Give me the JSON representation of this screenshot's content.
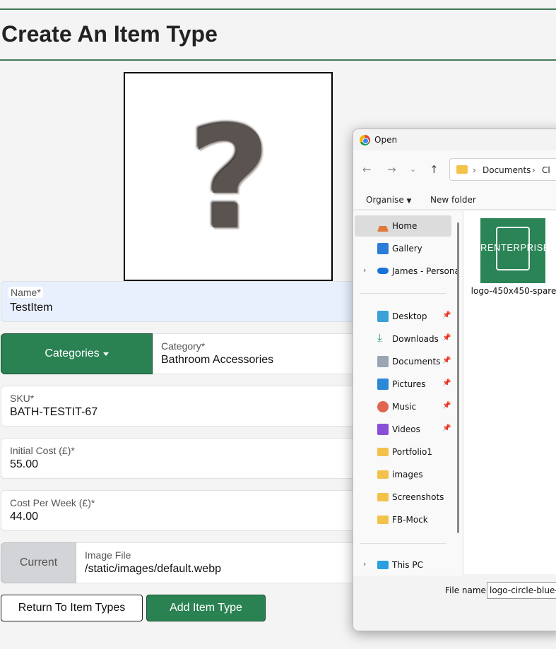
{
  "page": {
    "title": "Create An Item Type",
    "preview_glyph": "?"
  },
  "form": {
    "name": {
      "label": "Name*",
      "value": "TestItem"
    },
    "categories_button": "Categories",
    "category": {
      "label": "Category*",
      "value": "Bathroom Accessories"
    },
    "sku": {
      "label": "SKU*",
      "value": "BATH-TESTIT-67"
    },
    "initial_cost": {
      "label": "Initial Cost (£)*",
      "value": "55.00"
    },
    "cost_per_week": {
      "label": "Cost Per Week (£)*",
      "value": "44.00"
    },
    "current_button": "Current",
    "image_file": {
      "label": "Image File",
      "value": "/static/images/default.webp"
    },
    "return_button": "Return To Item Types",
    "add_button": "Add Item Type"
  },
  "dialog": {
    "title": "Open",
    "address": [
      "Documents",
      "Cl"
    ],
    "toolbar": {
      "organise": "Organise",
      "new_folder": "New folder"
    },
    "nav": [
      {
        "label": "Home",
        "icon": "home-icon"
      },
      {
        "label": "Gallery",
        "icon": "gallery-icon"
      },
      {
        "label": "James - Persona",
        "icon": "onedrive-icon"
      },
      {
        "label": "Desktop",
        "icon": "desktop-icon"
      },
      {
        "label": "Downloads",
        "icon": "download-icon"
      },
      {
        "label": "Documents",
        "icon": "document-icon"
      },
      {
        "label": "Pictures",
        "icon": "pictures-icon"
      },
      {
        "label": "Music",
        "icon": "music-icon"
      },
      {
        "label": "Videos",
        "icon": "video-icon"
      },
      {
        "label": "Portfolio1",
        "icon": "folder-icon"
      },
      {
        "label": "images",
        "icon": "folder-icon"
      },
      {
        "label": "Screenshots",
        "icon": "folder-icon"
      },
      {
        "label": "FB-Mock",
        "icon": "folder-icon"
      },
      {
        "label": "This PC",
        "icon": "pc-icon"
      }
    ],
    "file": {
      "thumb_text": "RENTERPRISE",
      "name": "logo-450x450-spare"
    },
    "file_name_label": "File name:",
    "file_name_value": "logo-circle-blue-b"
  },
  "colors": {
    "accent_green": "#2a8253",
    "name_field_bg": "#e8effd"
  }
}
